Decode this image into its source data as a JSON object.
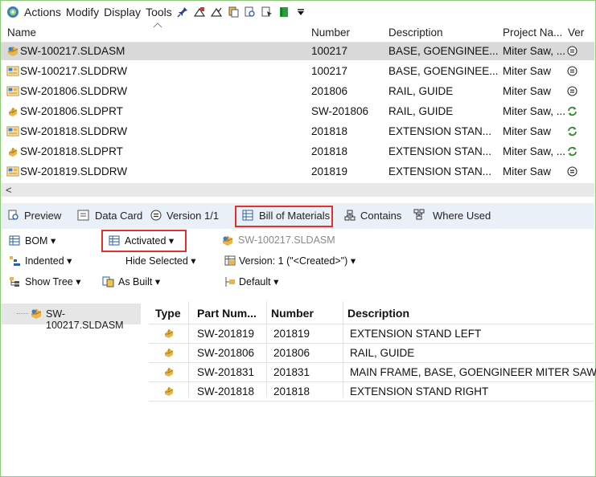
{
  "menu": {
    "items": [
      "Actions",
      "Modify",
      "Display",
      "Tools"
    ],
    "more_icon": "dropdown-triangle-icon"
  },
  "list": {
    "columns": [
      "Name",
      "Number",
      "Description",
      "Project Na...",
      "Ver"
    ],
    "rows": [
      {
        "name": "SW-100217.SLDASM",
        "number": "100217",
        "description": "BASE, GOENGINEE...",
        "project": "Miter Saw, ...",
        "status": "equal-circle-icon",
        "type": "assembly",
        "selected": true
      },
      {
        "name": "SW-100217.SLDDRW",
        "number": "100217",
        "description": "BASE, GOENGINEE...",
        "project": "Miter Saw",
        "status": "equal-circle-icon",
        "type": "drawing",
        "selected": false
      },
      {
        "name": "SW-201806.SLDDRW",
        "number": "201806",
        "description": "RAIL, GUIDE",
        "project": "Miter Saw",
        "status": "equal-circle-icon",
        "type": "drawing",
        "selected": false
      },
      {
        "name": "SW-201806.SLDPRT",
        "number": "SW-201806",
        "description": "RAIL, GUIDE",
        "project": "Miter Saw, ...",
        "status": "green-refresh-icon",
        "type": "part",
        "selected": false
      },
      {
        "name": "SW-201818.SLDDRW",
        "number": "201818",
        "description": "EXTENSION STAN...",
        "project": "Miter Saw",
        "status": "green-refresh-icon",
        "type": "drawing",
        "selected": false
      },
      {
        "name": "SW-201818.SLDPRT",
        "number": "201818",
        "description": "EXTENSION STAN...",
        "project": "Miter Saw, ...",
        "status": "green-refresh-icon",
        "type": "part",
        "selected": false
      },
      {
        "name": "SW-201819.SLDDRW",
        "number": "201819",
        "description": "EXTENSION STAN...",
        "project": "Miter Saw",
        "status": "equal-circle-icon",
        "type": "drawing",
        "selected": false
      }
    ],
    "scroll_left": "<"
  },
  "tabs": {
    "preview": "Preview",
    "data_card": "Data Card",
    "version": "Version 1/1",
    "bom": "Bill of Materials",
    "contains": "Contains",
    "where_used": "Where Used"
  },
  "bom_panel": {
    "bom_dropdown": "BOM",
    "activated": "Activated",
    "file_name": "SW-100217.SLDASM",
    "indented": "Indented",
    "hide_selected": "Hide Selected",
    "version": "Version: 1 (\"<Created>\")",
    "show_tree": "Show Tree",
    "as_built": "As Built",
    "default_config": "Default"
  },
  "tree": {
    "root": "SW-100217.SLDASM"
  },
  "bom_table": {
    "columns": [
      "Type",
      "Part Num...",
      "Number",
      "Description"
    ],
    "rows": [
      {
        "part": "SW-201819",
        "number": "201819",
        "description": "EXTENSION STAND LEFT"
      },
      {
        "part": "SW-201806",
        "number": "201806",
        "description": "RAIL, GUIDE"
      },
      {
        "part": "SW-201831",
        "number": "201831",
        "description": "MAIN FRAME, BASE, GOENGINEER MITER SAW"
      },
      {
        "part": "SW-201818",
        "number": "201818",
        "description": "EXTENSION STAND RIGHT"
      }
    ]
  },
  "colors": {
    "highlight_box": "#e0312c",
    "tab_bar": "#e9f0f8",
    "selected_row": "#d9d9d9",
    "frame": "#8fc97a",
    "part_icon": "#e8b64a",
    "status_green": "#2f8f2f"
  }
}
